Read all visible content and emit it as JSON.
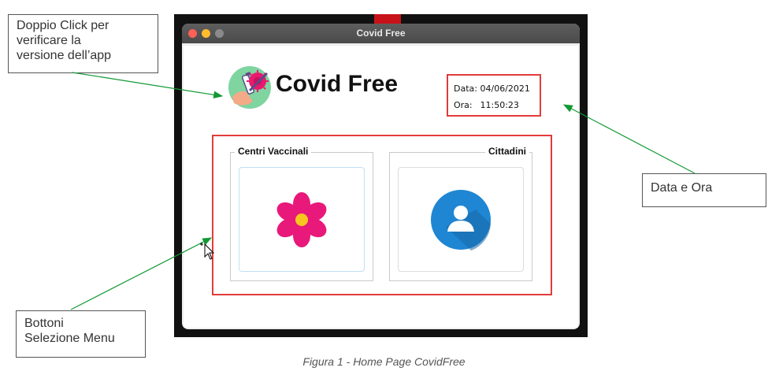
{
  "window": {
    "title": "Covid Free",
    "controls": [
      "close",
      "minimize",
      "maximize"
    ]
  },
  "app": {
    "name": "Covid Free",
    "logo_icon": "virus-vaccine-logo-icon"
  },
  "datetime": {
    "date_label": "Data:",
    "date_value": "04/06/2021",
    "time_label": "Ora:",
    "time_value": "11:50:23"
  },
  "menu": {
    "groups": [
      {
        "title": "Centri Vaccinali",
        "icon": "flower-icon"
      },
      {
        "title": "Cittadini",
        "icon": "user-icon"
      }
    ]
  },
  "annotations": {
    "app_version": "Doppio Click per\nverificare la\nversione dell’app",
    "data_ora": "Data e Ora",
    "bottoni": "Bottoni\nSelezione Menu"
  },
  "caption": "Figura 1 - Home Page CovidFree",
  "colors": {
    "highlight_border": "#e23b3b",
    "arrow": "#119933",
    "flower": "#e8197a",
    "flower_center": "#f7c51e",
    "user_circle": "#1f86d3"
  }
}
